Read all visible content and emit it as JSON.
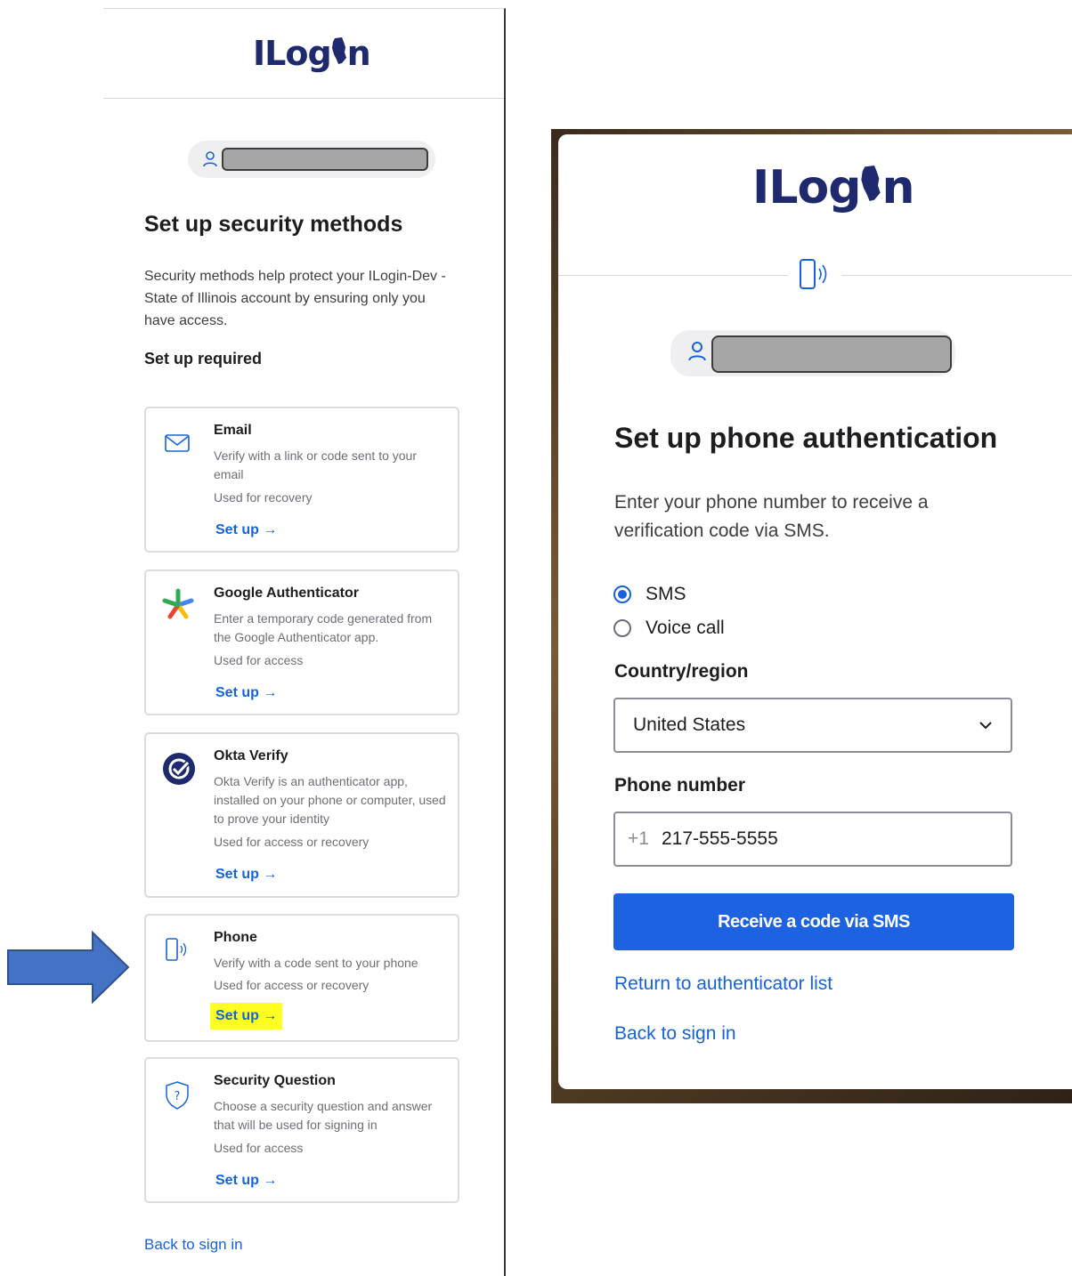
{
  "left_panel": {
    "logo_text": "ILogin",
    "title": "Set up security methods",
    "description": "Security methods help protect your ILogin-Dev - State of Illinois account by ensuring only you have access.",
    "section_heading": "Set up required",
    "authenticators": [
      {
        "title": "Email",
        "description": "Verify with a link or code sent to your email",
        "usage": "Used for recovery",
        "setup_label": "Set up →",
        "icon": "envelope-icon"
      },
      {
        "title": "Google Authenticator",
        "description": "Enter a temporary code generated from the Google Authenticator app.",
        "usage": "Used for access",
        "setup_label": "Set up →",
        "icon": "google-authenticator-icon"
      },
      {
        "title": "Okta Verify",
        "description": "Okta Verify is an authenticator app, installed on your phone or computer, used to prove your identity",
        "usage": "Used for access or recovery",
        "setup_label": "Set up →",
        "icon": "okta-verify-icon"
      },
      {
        "title": "Phone",
        "description": "Verify with a code sent to your phone",
        "usage": "Used for access or recovery",
        "setup_label": "Set up →",
        "icon": "phone-icon"
      },
      {
        "title": "Security Question",
        "description": "Choose a security question and answer that will be used for signing in",
        "usage": "Used for access",
        "setup_label": "Set up →",
        "icon": "shield-question-icon"
      }
    ],
    "back_link": "Back to sign in"
  },
  "right_panel": {
    "logo_text": "ILogin",
    "title": "Set up phone authentication",
    "description": "Enter your phone number to receive a verification code via SMS.",
    "methods": [
      {
        "label": "SMS",
        "checked": true
      },
      {
        "label": "Voice call",
        "checked": false
      }
    ],
    "country_label": "Country/region",
    "country_value": "United States",
    "phone_label": "Phone number",
    "phone_prefix": "+1",
    "phone_value": "217-555-5555",
    "submit_label": "Receive a code via SMS",
    "return_link": "Return to authenticator list",
    "back_link": "Back to sign in"
  },
  "colors": {
    "brand_navy": "#1f2a6e",
    "link_blue": "#1662dd",
    "button_blue": "#1d62e0",
    "highlight_yellow": "#ffff1f",
    "arrow_blue": "#4472c4"
  }
}
